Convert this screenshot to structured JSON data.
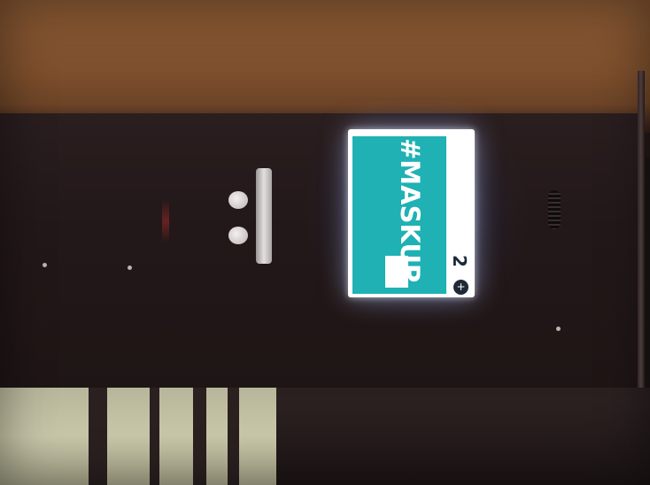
{
  "display": {
    "hashtag": "#MASKUP",
    "count": "2",
    "count_icon": "+"
  },
  "colors": {
    "screen_teal": "#1fb1b3",
    "screen_white": "#ffffff",
    "device_body": "#231819",
    "background_wood": "#8a5a34"
  },
  "icons": {
    "count_icon": "plus-circle-icon"
  }
}
